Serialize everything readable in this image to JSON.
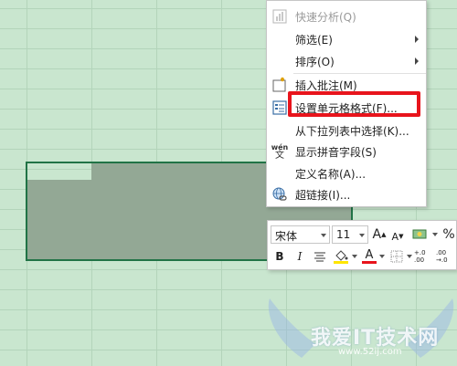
{
  "context_menu": {
    "items": [
      {
        "label": "快速分析(Q)",
        "icon": "quick-analysis-icon",
        "disabled": true
      },
      {
        "label": "筛选(E)",
        "submenu": true
      },
      {
        "label": "排序(O)",
        "submenu": true
      },
      {
        "label": "插入批注(M)",
        "icon": "insert-comment-icon"
      },
      {
        "label": "设置单元格格式(F)...",
        "icon": "format-cells-icon",
        "highlighted": true
      },
      {
        "label": "从下拉列表中选择(K)..."
      },
      {
        "label": "显示拼音字段(S)",
        "icon": "phonetic-guide-icon"
      },
      {
        "label": "定义名称(A)..."
      },
      {
        "label": "超链接(I)...",
        "icon": "hyperlink-icon"
      }
    ],
    "phonetic_icon_text_top": "wén",
    "phonetic_icon_text_bottom": "文"
  },
  "mini_toolbar": {
    "font_name": "宋体",
    "font_size": "11",
    "increase_font_label": "A",
    "decrease_font_label": "A",
    "percent_label": "%",
    "bold_label": "B",
    "italic_label": "I",
    "font_color_label": "A",
    "increase_decimal_label": "+.0 .00",
    "decrease_decimal_label": ".00 →.0",
    "font_color": "#e8141c",
    "fill_color": "#ffe600"
  },
  "watermark": {
    "title": "我爱IT技术网",
    "url": "www.52ij.com"
  },
  "colors": {
    "sheet_bg": "#c9e6cf",
    "selection_fill": "#93a895",
    "selection_border": "#217346",
    "highlight_red": "#e8141c"
  }
}
